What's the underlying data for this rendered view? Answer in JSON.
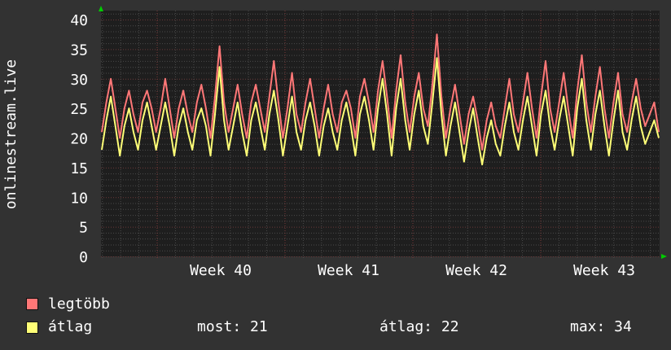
{
  "chart_data": {
    "type": "line",
    "ylabel": "onlinestream.live",
    "ylim": [
      0,
      40
    ],
    "yticks": [
      "0",
      "5",
      "10",
      "15",
      "20",
      "25",
      "30",
      "35",
      "40"
    ],
    "xlabels": [
      "Week 40",
      "Week 41",
      "Week 42",
      "Week 43"
    ],
    "days": 31,
    "points_per_day": 4,
    "grid": true,
    "series": [
      {
        "name": "legtöbb",
        "color": "#ff7777",
        "values": [
          21,
          26,
          30,
          25,
          20,
          25,
          28,
          24,
          21,
          26,
          28,
          25,
          21,
          25,
          30,
          25,
          20,
          25,
          28,
          24,
          21,
          26,
          29,
          25,
          20,
          27,
          35.5,
          26,
          21,
          25,
          29,
          24,
          20,
          26,
          29,
          25,
          21,
          27,
          33,
          26,
          20,
          25,
          31,
          24,
          21,
          26,
          30,
          25,
          20,
          25,
          29,
          24,
          21,
          26,
          28,
          25,
          20,
          27,
          30,
          26,
          21,
          28,
          33,
          27,
          20,
          28,
          34,
          26,
          21,
          27,
          31,
          25,
          22,
          29,
          37.5,
          27,
          20,
          25,
          29,
          24,
          19,
          24,
          27,
          23,
          18,
          23,
          26,
          22,
          20,
          25,
          30,
          24,
          21,
          26,
          31,
          25,
          20,
          27,
          33,
          25,
          21,
          26,
          31,
          25,
          20,
          28,
          34,
          26,
          21,
          27,
          32,
          25,
          20,
          26,
          31,
          24,
          21,
          26,
          30,
          25,
          22,
          24,
          26,
          21
        ]
      },
      {
        "name": "átlag",
        "color": "#ffff77",
        "values": [
          18,
          23,
          27,
          22,
          17,
          22,
          25,
          21,
          18,
          23,
          26,
          22,
          18,
          22,
          26,
          22,
          17,
          22,
          25,
          21,
          18,
          23,
          25,
          22,
          17,
          24,
          32,
          23,
          18,
          22,
          26,
          21,
          17,
          23,
          26,
          22,
          18,
          24,
          28,
          23,
          17,
          22,
          27,
          21,
          18,
          23,
          26,
          22,
          17,
          22,
          25,
          21,
          18,
          23,
          26,
          22,
          17,
          24,
          27,
          23,
          18,
          25,
          30,
          24,
          17,
          25,
          30,
          23,
          18,
          24,
          28,
          22,
          19,
          26,
          33.5,
          24,
          17,
          22,
          26,
          21,
          16,
          21,
          25,
          20,
          15.5,
          20,
          23,
          19,
          17,
          22,
          26,
          21,
          18,
          23,
          27,
          22,
          17,
          24,
          28,
          22,
          18,
          23,
          27,
          22,
          17,
          25,
          30,
          23,
          18,
          24,
          28,
          22,
          17,
          23,
          28,
          21,
          18,
          23,
          27,
          22,
          19,
          21,
          23,
          20
        ]
      }
    ]
  },
  "legend": {
    "max_label": "legtöbb",
    "avg_label": "átlag",
    "now": "most: 21",
    "average": "átlag: 22",
    "maximum": "max: 34"
  },
  "colors": {
    "background": "#323232",
    "plot": "#1e1e1e",
    "max": "#ff7777",
    "avg": "#ffff77",
    "arrow": "#00cc00"
  }
}
